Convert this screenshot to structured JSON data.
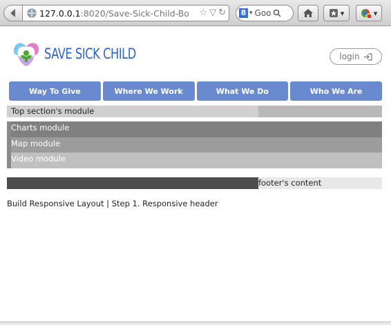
{
  "browser": {
    "url_host": "127.0.0.1",
    "url_path": ":8020/Save-Sick-Child-Bo",
    "search_placeholder": "Goo",
    "search_engine_letter": "8"
  },
  "header": {
    "logo_text": "SAVE SICK CHILD",
    "login_label": "login"
  },
  "nav": {
    "items": [
      {
        "label": "Way To Give"
      },
      {
        "label": "Where We Work"
      },
      {
        "label": "What We Do"
      },
      {
        "label": "Who We Are"
      }
    ]
  },
  "sections": {
    "top": "Top section's module",
    "charts": "Charts module",
    "map": "Map module",
    "video": "Video module",
    "footer": "footer's content"
  },
  "caption": "Build Responsive Layout | Step 1. Responsive header",
  "colors": {
    "nav_bg": "#6a8ad0",
    "logo_text": "#2e63c9"
  },
  "icons": {
    "back": "back-arrow-icon",
    "page": "globe-icon",
    "bookmark_star": "star-icon",
    "history": "history-dropdown-icon",
    "reload": "reload-icon",
    "search": "search-icon",
    "home": "home-icon",
    "bookmarks": "bookmarks-icon",
    "addon": "addon-icon",
    "login": "login-arrow-icon"
  }
}
